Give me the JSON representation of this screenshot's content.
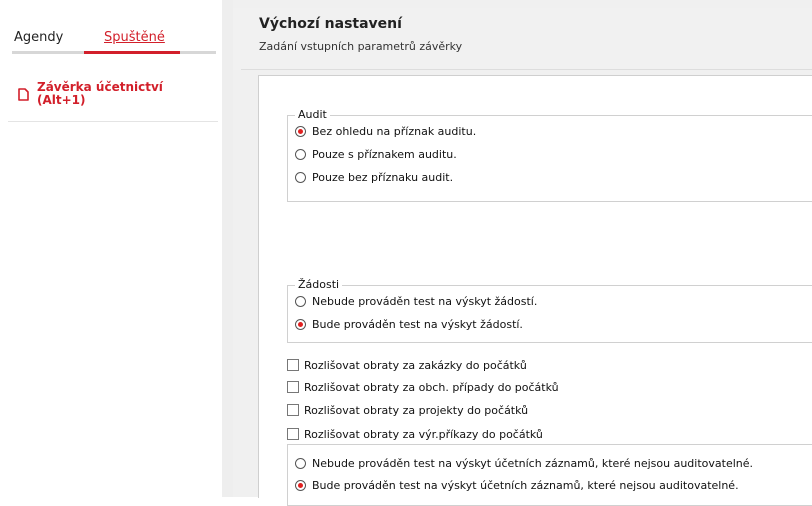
{
  "sidebar": {
    "tabs": [
      {
        "label": "Agendy",
        "active": false
      },
      {
        "label": "Spuštěné",
        "active": true
      }
    ],
    "items": [
      {
        "label": "Závěrka účetnictví (Alt+1)",
        "icon": "document-icon"
      }
    ]
  },
  "header": {
    "title": "Výchozí nastavení",
    "subtitle": "Zadání vstupních parametrů závěrky"
  },
  "audit": {
    "legend": "Audit",
    "options": [
      {
        "label": "Bez ohledu na příznak auditu.",
        "selected": true
      },
      {
        "label": "Pouze s příznakem auditu.",
        "selected": false
      },
      {
        "label": "Pouze bez příznaku audit.",
        "selected": false
      }
    ]
  },
  "zadosti": {
    "legend": "Žádosti",
    "options": [
      {
        "label": "Nebude prováděn test na výskyt žádostí.",
        "selected": false
      },
      {
        "label": "Bude prováděn test na výskyt žádostí.",
        "selected": true
      }
    ]
  },
  "checkboxes": [
    {
      "label": "Rozlišovat obraty za zakázky do počátků",
      "checked": false
    },
    {
      "label": "Rozlišovat obraty za obch. případy do počátků",
      "checked": false
    },
    {
      "label": "Rozlišovat obraty za projekty do počátků",
      "checked": false
    },
    {
      "label": "Rozlišovat obraty za výr.příkazy do počátků",
      "checked": false
    }
  ],
  "ucetni": {
    "options": [
      {
        "label": "Nebude prováděn test na výskyt účetních záznamů, které nejsou auditovatelné.",
        "selected": false
      },
      {
        "label": "Bude prováděn test na výskyt účetních záznamů, které nejsou auditovatelné.",
        "selected": true
      }
    ]
  },
  "colors": {
    "accent": "#d21f2a"
  }
}
